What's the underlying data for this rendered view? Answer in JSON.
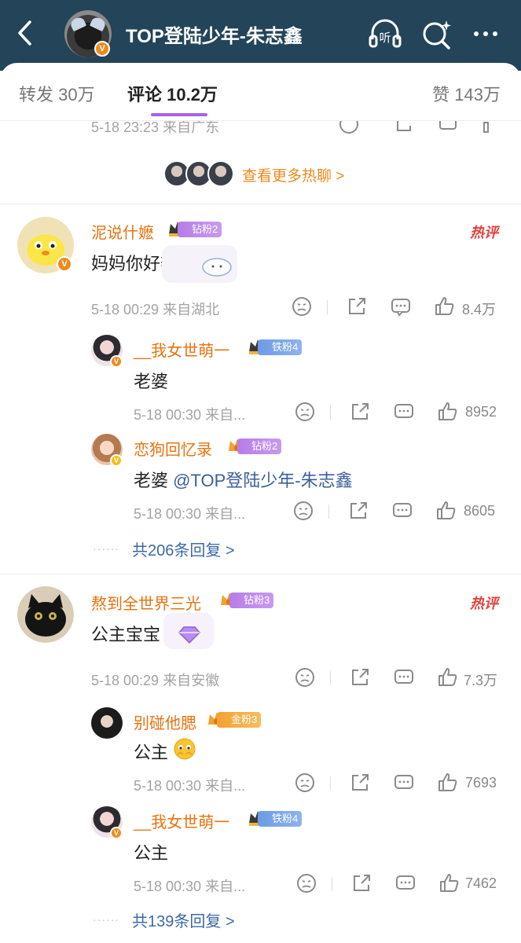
{
  "header": {
    "title": "TOP登陆少年-朱志鑫",
    "back_icon": "chevron-left-icon",
    "listen_icon": "headphones-listen-icon",
    "listen_label": "听",
    "search_icon": "search-sparkle-icon",
    "more_icon": "more-dots-icon",
    "verified_badge": "V",
    "bg_color": "#234459"
  },
  "tabs": [
    {
      "label": "转发 30万"
    },
    {
      "label": "评论 10.2万"
    },
    {
      "label": "赞 143万"
    }
  ],
  "prev_comment_meta": "5-18 23:23 来自广东",
  "more_hot": {
    "label": "查看更多热聊 >"
  },
  "hot_tag": "热评",
  "comments": [
    {
      "username": "泥说什嬷",
      "fan_badge": "钻粉2",
      "content": "妈妈你好辣",
      "meta": "5-18 00:29 来自湖北",
      "likes": "8.4万",
      "replies": [
        {
          "username": "__我女世萌一",
          "fan_badge": "铁粉4",
          "content": "老婆",
          "meta": "5-18 00:30 来自...",
          "likes": "8952"
        },
        {
          "username": "恋狗回忆录",
          "fan_badge": "钻粉2",
          "content_prefix": "老婆 ",
          "mention": "@TOP登陆少年-朱志鑫",
          "meta": "5-18 00:30 来自...",
          "likes": "8605"
        }
      ],
      "view_replies": "共206条回复 >"
    },
    {
      "username": "熬到全世界三光",
      "fan_badge": "钻粉3",
      "content": "公主宝宝",
      "meta": "5-18 00:29 来自安徽",
      "likes": "7.3万",
      "replies": [
        {
          "username": "别碰他腮",
          "fan_badge": "金粉3",
          "content": "公主",
          "meta": "5-18 00:30 来自...",
          "likes": "7693"
        },
        {
          "username": "__我女世萌一",
          "fan_badge": "铁粉4",
          "content": "公主",
          "meta": "5-18 00:30 来自...",
          "likes": "7462"
        }
      ],
      "view_replies": "共139条回复 >"
    }
  ],
  "colors": {
    "username": "#e8730f",
    "link": "#3d6aa6",
    "hot": "#e2423d",
    "tab_underline": "#a860e8"
  }
}
